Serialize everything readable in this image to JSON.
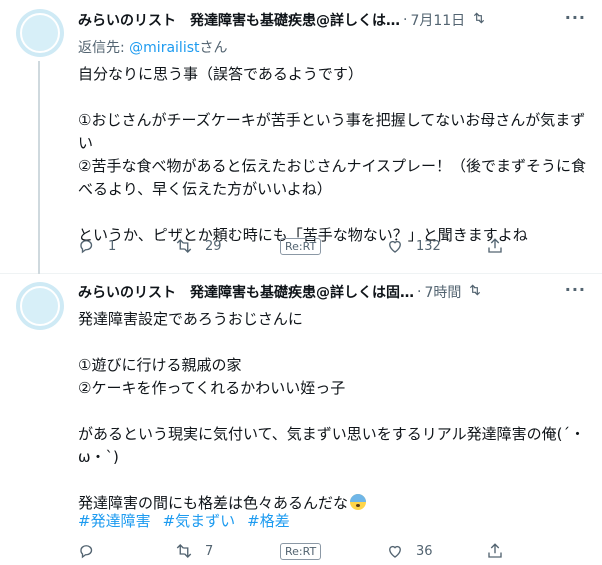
{
  "tweets": [
    {
      "name": "みらいのリスト　発達障害も基礎疾患@詳しくは…",
      "time": "7月11日",
      "reply_prefix": "返信先: ",
      "reply_handle": "@mirailist",
      "reply_suffix": "さん",
      "paragraphs": [
        "自分なりに思う事（誤答であるようです）",
        "①おじさんがチーズケーキが苦手という事を把握してないお母さんが気まずい\n②苦手な食べ物があると伝えたおじさんナイスプレー！（後でまずそうに食べるより、早く伝えた方がいいよね）",
        "というか、ピザとか頼む時にも「苦手な物ない？」と聞きますよね"
      ],
      "actions": {
        "reply": "1",
        "retweet": "29",
        "rert": "Re:RT",
        "like": "132"
      }
    },
    {
      "name": "みらいのリスト　発達障害も基礎疾患@詳しくは固…",
      "time": "7時間",
      "paragraphs": [
        "発達障害設定であろうおじさんに",
        "①遊びに行ける親戚の家\n②ケーキを作ってくれるかわいい姪っ子",
        "があるという現実に気付いて、気まずい思いをするリアル発達障害の俺(´・ω・`)",
        "発達障害の間にも格差は色々あるんだな"
      ],
      "hashtags": [
        "#発達障害",
        "#気まずい",
        "#格差"
      ],
      "actions": {
        "reply": "",
        "retweet": "7",
        "rert": "Re:RT",
        "like": "36"
      }
    }
  ],
  "icons": [
    "avatar",
    "retweet-indicator-icon",
    "more-icon",
    "reply-icon",
    "retweet-icon",
    "like-icon",
    "share-icon",
    "anxious-face-emoji"
  ],
  "colors": {
    "link": "#1d9bf0",
    "secondary_text": "#536471",
    "primary_text": "#0f1419",
    "divider": "#eff3f4"
  }
}
